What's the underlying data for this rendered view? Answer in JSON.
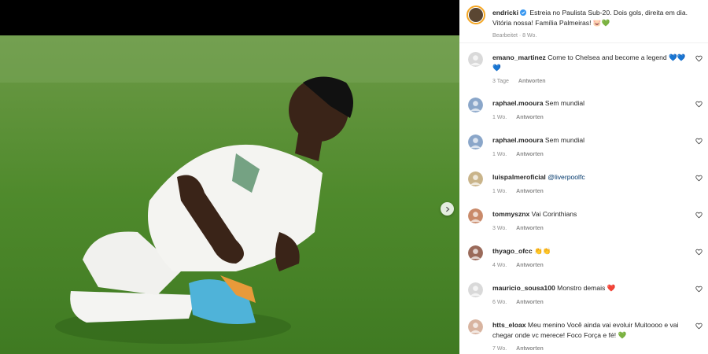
{
  "post": {
    "username": "endricki",
    "caption": "Estreia no Paulista Sub-20. Dois gols, direita em dia. Vitória nossa! Família Palmeiras! 🐷💚",
    "edited_label": "Bearbeitet · 8 Wo."
  },
  "reply_label": "Antworten",
  "comments": [
    {
      "username": "emano_martinez",
      "text": "Come to Chelsea and become a legend 💙💙💙",
      "time": "3 Tage"
    },
    {
      "username": "raphael.mooura",
      "text": "Sem mundial",
      "time": "1 Wo."
    },
    {
      "username": "raphael.mooura",
      "text": "Sem mundial",
      "time": "1 Wo."
    },
    {
      "username": "luispalmeroficial",
      "text": "@liverpoolfc",
      "time": "1 Wo."
    },
    {
      "username": "tommysznx",
      "text": "Vai Corinthians",
      "time": "3 Wo."
    },
    {
      "username": "thyago_ofcc",
      "text": "👏👏",
      "time": "4 Wo."
    },
    {
      "username": "mauricio_sousa100",
      "text": "Monstro demais ❤️",
      "time": "6 Wo."
    },
    {
      "username": "htts_eloax",
      "text": "Meu menino Você ainda vai evoluir Muitoooo e vai chegar onde vc merece! Foco Força e fé! 💚",
      "time": "7 Wo."
    }
  ],
  "colors": {
    "field_green": "#4f8a2c",
    "verified_blue": "#3897f0",
    "link_blue": "#00376b"
  },
  "icons": {
    "next": "chevron-right-icon",
    "like": "heart-outline-icon",
    "verified": "verified-badge-icon"
  }
}
